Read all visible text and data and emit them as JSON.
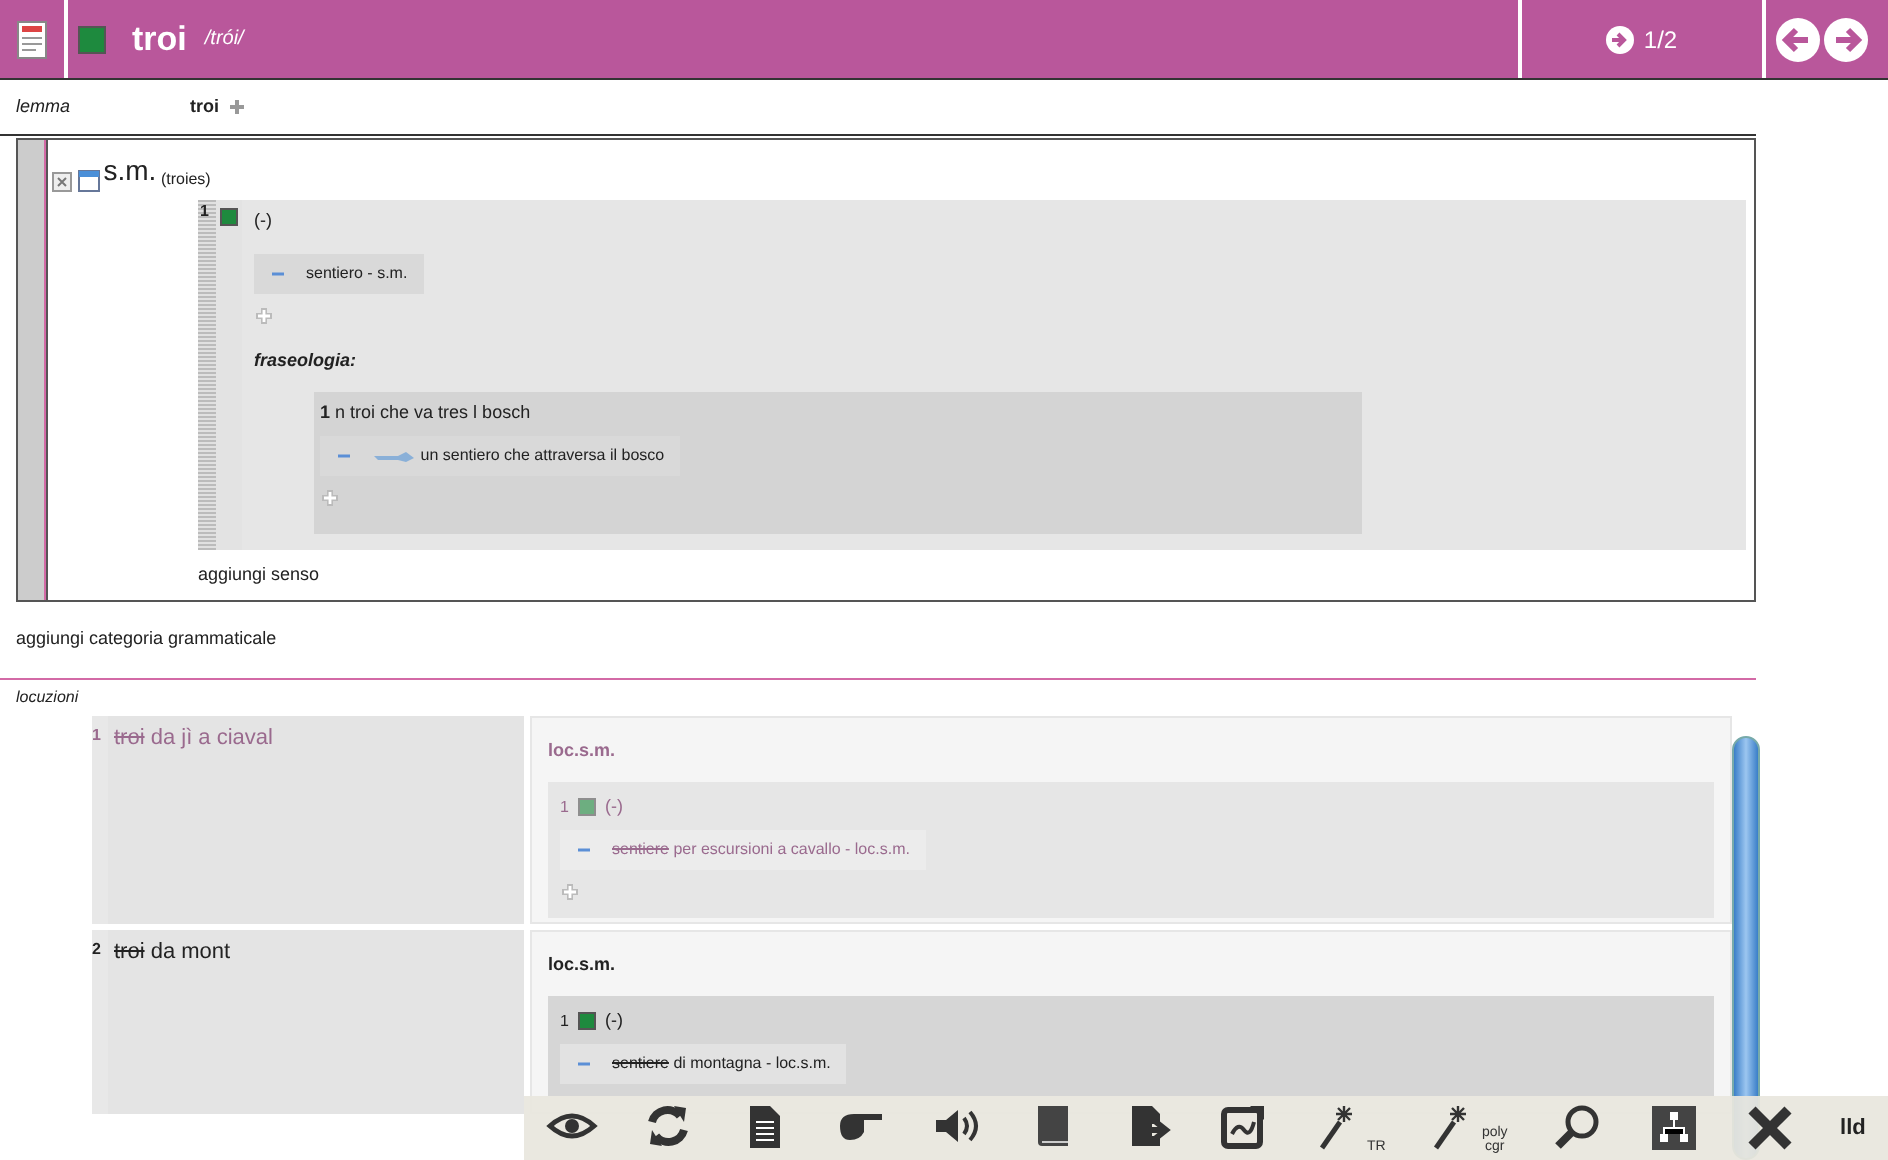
{
  "header": {
    "title": "troi",
    "pronunciation": "/trói/",
    "pager": "1/2"
  },
  "lemma": {
    "label": "lemma",
    "value": "troi"
  },
  "categories": [
    {
      "name": "s.m.",
      "plural": "(troies)",
      "add_sense": "aggiungi senso",
      "senses": [
        {
          "number": "1",
          "definition": "(-)",
          "translations": [
            "sentiero  - s.m."
          ],
          "phraseology_label": "fraseologia:",
          "phrases": [
            {
              "number": "1",
              "text": "n troi che va tres l bosch",
              "translations": [
                "un sentiero che attraversa il bosco"
              ]
            }
          ]
        }
      ]
    }
  ],
  "add_category": "aggiungi categoria grammaticale",
  "locutions_label": "locuzioni",
  "locutions": [
    {
      "number": "1",
      "dimmed": true,
      "struck": "troi",
      "rest": " da jì a ciaval",
      "category": "loc.s.m.",
      "senses": [
        {
          "number": "1",
          "definition": "(-)",
          "translation_struck": "sentiere",
          "translation_rest": " per escursioni a cavallo  - loc.s.m.",
          "add": true
        }
      ]
    },
    {
      "number": "2",
      "dimmed": false,
      "struck": "troi",
      "rest": " da mont",
      "category": "loc.s.m.",
      "senses": [
        {
          "number": "1",
          "definition": "(-)",
          "translation_struck": "sentiere",
          "translation_rest": " di montagna  - loc.s.m.",
          "add": false
        }
      ]
    }
  ],
  "toolbar": {
    "tools": [
      {
        "kind": "eye"
      },
      {
        "kind": "refresh"
      },
      {
        "kind": "document"
      },
      {
        "kind": "hand"
      },
      {
        "kind": "speaker"
      },
      {
        "kind": "book"
      },
      {
        "kind": "export"
      },
      {
        "kind": "chart"
      },
      {
        "kind": "wand",
        "caption": [
          "TR"
        ]
      },
      {
        "kind": "wand",
        "caption": [
          "poly",
          "cgr"
        ]
      },
      {
        "kind": "search"
      },
      {
        "kind": "tree"
      },
      {
        "kind": "close"
      }
    ],
    "label": "lld"
  }
}
